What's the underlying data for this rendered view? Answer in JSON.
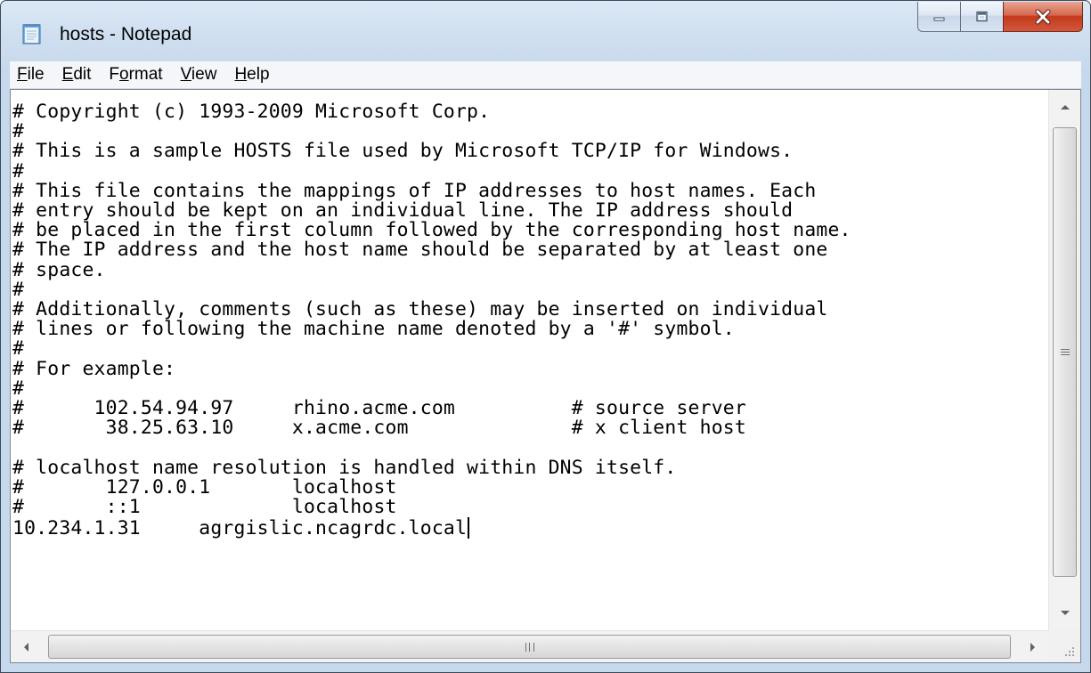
{
  "window": {
    "title": "hosts - Notepad",
    "icon": "notepad-icon"
  },
  "caption_buttons": {
    "minimize_icon": "minimize-icon",
    "maximize_icon": "maximize-icon",
    "close_icon": "close-icon"
  },
  "menu": {
    "items": [
      {
        "accel": "F",
        "rest": "ile"
      },
      {
        "accel": "E",
        "rest": "dit"
      },
      {
        "pre": "F",
        "accel": "o",
        "rest": "rmat"
      },
      {
        "accel": "V",
        "rest": "iew"
      },
      {
        "accel": "H",
        "rest": "elp"
      }
    ]
  },
  "editor": {
    "lines": [
      "# Copyright (c) 1993-2009 Microsoft Corp.",
      "#",
      "# This is a sample HOSTS file used by Microsoft TCP/IP for Windows.",
      "#",
      "# This file contains the mappings of IP addresses to host names. Each",
      "# entry should be kept on an individual line. The IP address should",
      "# be placed in the first column followed by the corresponding host name.",
      "# The IP address and the host name should be separated by at least one",
      "# space.",
      "#",
      "# Additionally, comments (such as these) may be inserted on individual",
      "# lines or following the machine name denoted by a '#' symbol.",
      "#",
      "# For example:",
      "#",
      "#      102.54.94.97     rhino.acme.com          # source server",
      "#       38.25.63.10     x.acme.com              # x client host",
      "",
      "# localhost name resolution is handled within DNS itself.",
      "#\t127.0.0.1       localhost",
      "#\t::1             localhost",
      "10.234.1.31\tagrgislic.ncagrdc.local"
    ]
  },
  "scrollbars": {
    "vertical": {
      "up_icon": "scroll-up-arrow-icon",
      "down_icon": "scroll-down-arrow-icon"
    },
    "horizontal": {
      "left_icon": "scroll-left-arrow-icon",
      "right_icon": "scroll-right-arrow-icon"
    }
  },
  "colors": {
    "close_button": "#c4391b",
    "title_bar": "#cfdff0",
    "editor_background": "#ffffff"
  }
}
